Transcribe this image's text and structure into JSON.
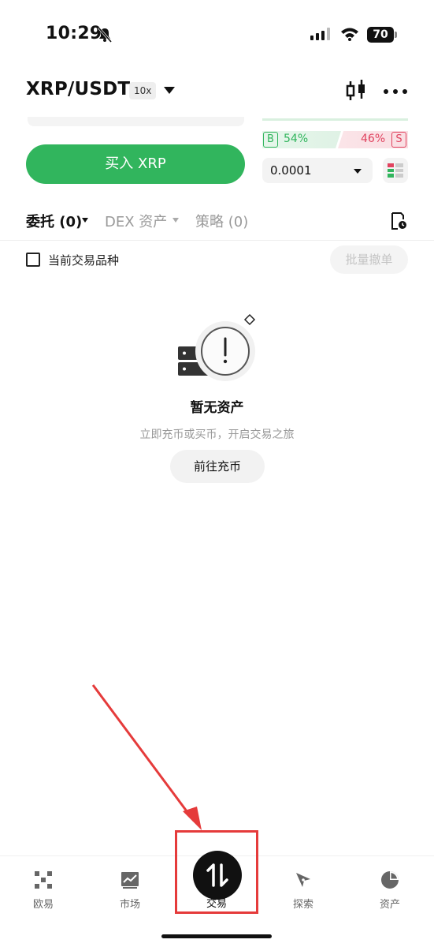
{
  "status_bar": {
    "time": "10:29",
    "battery": "70"
  },
  "header": {
    "pair": "XRP/USDT",
    "leverage": "10x"
  },
  "order_form": {
    "buy_button_label": "买入 XRP",
    "buy_badge": "B",
    "buy_ratio": "54%",
    "sell_ratio": "46%",
    "sell_badge": "S",
    "precision_value": "0.0001"
  },
  "tabs": [
    {
      "label": "委托 (0)"
    },
    {
      "label": "DEX 资产"
    },
    {
      "label": "策略 (0)"
    }
  ],
  "filter": {
    "current_pair_label": "当前交易品种",
    "cancel_all_label": "批量撤单"
  },
  "empty_state": {
    "title": "暂无资产",
    "subtitle": "立即充币或买币，开启交易之旅",
    "button_label": "前往充币"
  },
  "bottom_nav": [
    {
      "label": "欧易",
      "icon": "okx-logo-icon"
    },
    {
      "label": "市场",
      "icon": "market-chart-icon"
    },
    {
      "label": "交易",
      "icon": "trade-swap-icon"
    },
    {
      "label": "探索",
      "icon": "compass-icon"
    },
    {
      "label": "资产",
      "icon": "pie-chart-icon"
    }
  ],
  "colors": {
    "buy": "#31b55d",
    "sell": "#e0435f",
    "annotation": "#e53b3b"
  }
}
